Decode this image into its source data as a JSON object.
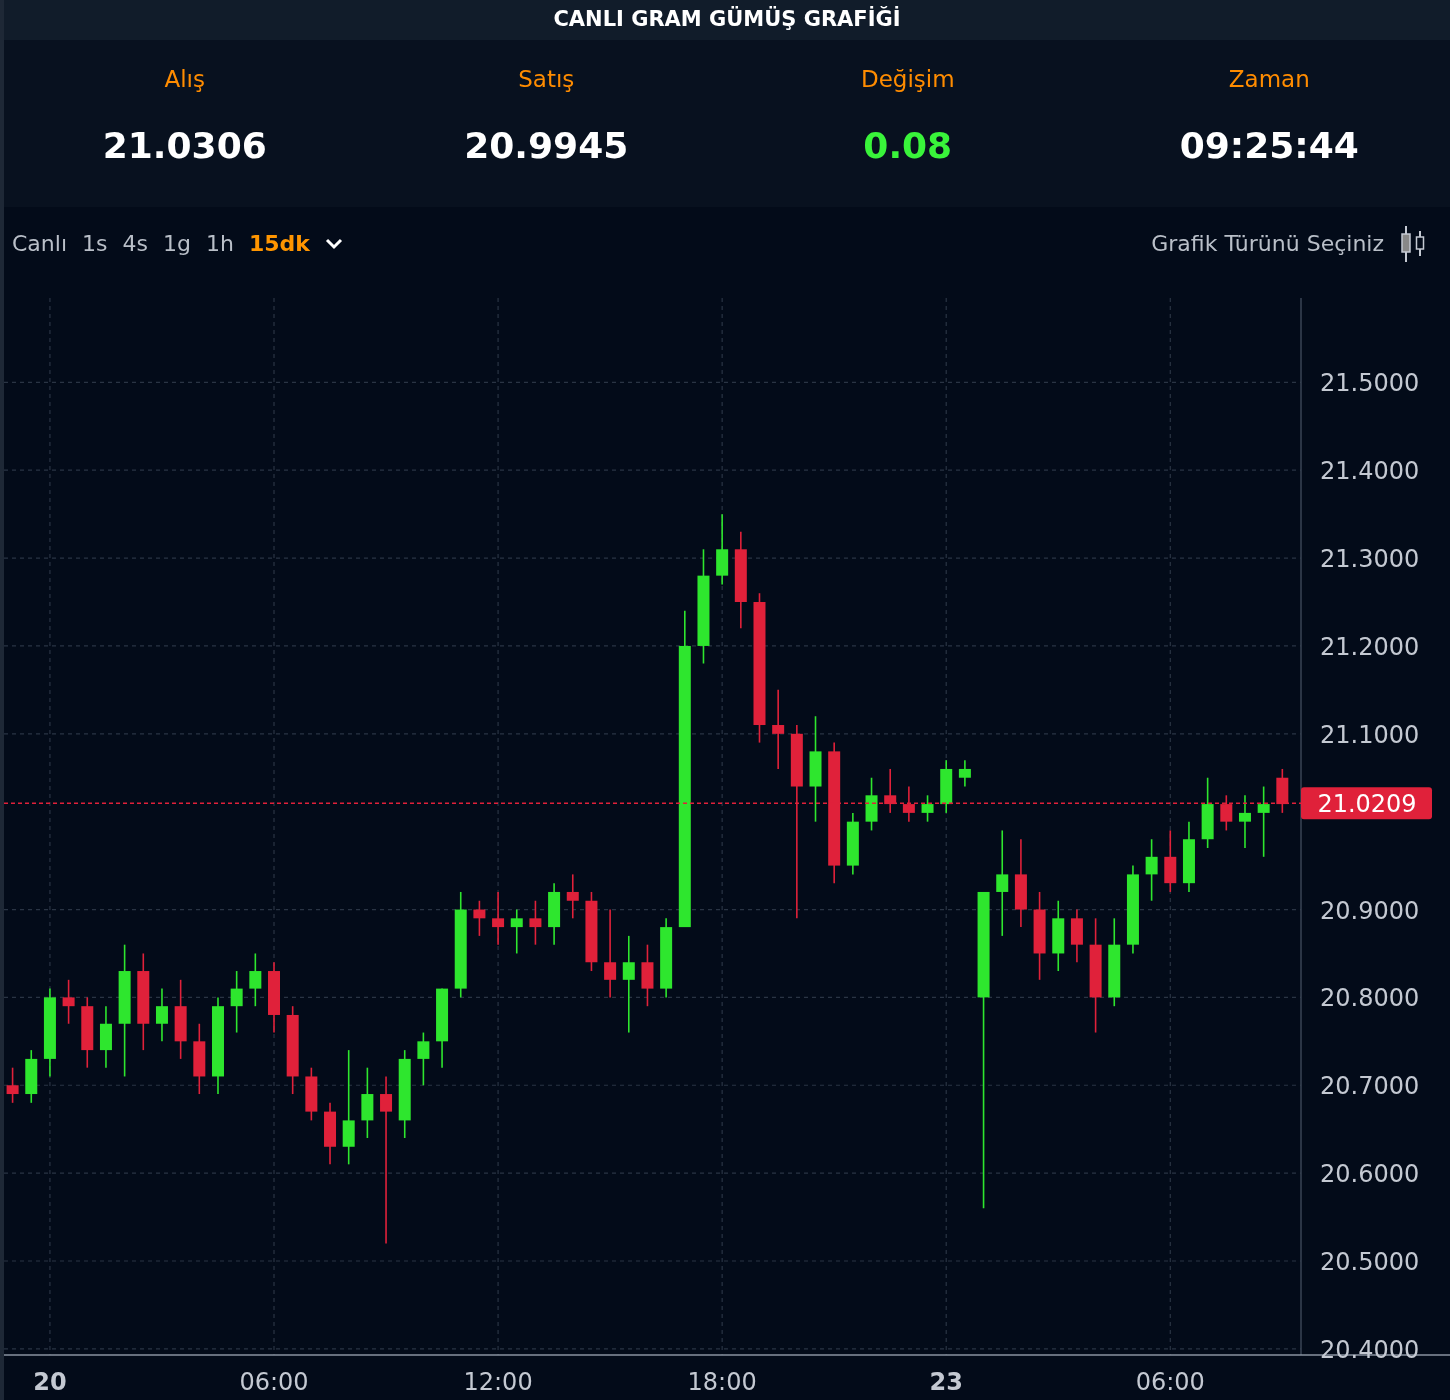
{
  "title": "CANLI GRAM GÜMÜŞ GRAFİĞİ",
  "stats": [
    {
      "label": "Alış",
      "value": "21.0306",
      "color": "#ffffff"
    },
    {
      "label": "Satış",
      "value": "20.9945",
      "color": "#ffffff"
    },
    {
      "label": "Değişim",
      "value": "0.08",
      "color": "#39f43a"
    },
    {
      "label": "Zaman",
      "value": "09:25:44",
      "color": "#ffffff"
    }
  ],
  "intervals": [
    {
      "label": "Canlı",
      "selected": false
    },
    {
      "label": "1s",
      "selected": false
    },
    {
      "label": "4s",
      "selected": false
    },
    {
      "label": "1g",
      "selected": false
    },
    {
      "label": "1h",
      "selected": false
    },
    {
      "label": "15dk",
      "selected": true
    }
  ],
  "chart_type_label": "Grafik Türünü Seçiniz",
  "chart_data": {
    "type": "candlestick",
    "ylim": [
      20.393,
      21.596
    ],
    "categories": [
      null,
      null,
      "20",
      null,
      null,
      null,
      null,
      null,
      null,
      null,
      null,
      null,
      null,
      null,
      "06:00",
      null,
      null,
      null,
      null,
      null,
      null,
      null,
      null,
      null,
      null,
      null,
      "12:00",
      null,
      null,
      null,
      null,
      null,
      null,
      null,
      null,
      null,
      null,
      null,
      "18:00",
      null,
      null,
      null,
      null,
      null,
      null,
      null,
      null,
      null,
      null,
      null,
      "23",
      null,
      null,
      null,
      null,
      null,
      null,
      null,
      null,
      null,
      null,
      null,
      "06:00",
      null,
      null,
      null,
      null,
      null,
      null
    ],
    "yticks": [
      {
        "value": 21.5,
        "label": "21.5000"
      },
      {
        "value": 21.4,
        "label": "21.4000"
      },
      {
        "value": 21.3,
        "label": "21.3000"
      },
      {
        "value": 21.2,
        "label": "21.2000"
      },
      {
        "value": 21.1,
        "label": "21.1000"
      },
      {
        "value": 20.9,
        "label": "20.9000"
      },
      {
        "value": 20.8,
        "label": "20.8000"
      },
      {
        "value": 20.7,
        "label": "20.7000"
      },
      {
        "value": 20.6,
        "label": "20.6000"
      },
      {
        "value": 20.5,
        "label": "20.5000"
      },
      {
        "value": 20.4,
        "label": "20.4000"
      }
    ],
    "series": [
      {
        "ohlc": [
          [
            20.7,
            20.72,
            20.68,
            20.69
          ],
          [
            20.69,
            20.74,
            20.68,
            20.73
          ],
          [
            20.73,
            20.81,
            20.71,
            20.8
          ],
          [
            20.8,
            20.82,
            20.77,
            20.79
          ],
          [
            20.79,
            20.8,
            20.72,
            20.74
          ],
          [
            20.74,
            20.79,
            20.72,
            20.77
          ],
          [
            20.77,
            20.86,
            20.71,
            20.83
          ],
          [
            20.83,
            20.85,
            20.74,
            20.77
          ],
          [
            20.77,
            20.81,
            20.75,
            20.79
          ],
          [
            20.79,
            20.82,
            20.73,
            20.75
          ],
          [
            20.75,
            20.77,
            20.69,
            20.71
          ],
          [
            20.71,
            20.8,
            20.69,
            20.79
          ],
          [
            20.79,
            20.83,
            20.76,
            20.81
          ],
          [
            20.81,
            20.85,
            20.79,
            20.83
          ],
          [
            20.83,
            20.84,
            20.76,
            20.78
          ],
          [
            20.78,
            20.79,
            20.69,
            20.71
          ],
          [
            20.71,
            20.72,
            20.66,
            20.67
          ],
          [
            20.67,
            20.68,
            20.61,
            20.63
          ],
          [
            20.63,
            20.74,
            20.61,
            20.66
          ],
          [
            20.66,
            20.72,
            20.64,
            20.69
          ],
          [
            20.69,
            20.71,
            20.52,
            20.67
          ],
          [
            20.66,
            20.74,
            20.64,
            20.73
          ],
          [
            20.73,
            20.76,
            20.7,
            20.75
          ],
          [
            20.75,
            20.81,
            20.72,
            20.81
          ],
          [
            20.81,
            20.92,
            20.8,
            20.9
          ],
          [
            20.9,
            20.91,
            20.87,
            20.89
          ],
          [
            20.89,
            20.92,
            20.86,
            20.88
          ],
          [
            20.88,
            20.9,
            20.85,
            20.89
          ],
          [
            20.89,
            20.91,
            20.86,
            20.88
          ],
          [
            20.88,
            20.93,
            20.86,
            20.92
          ],
          [
            20.92,
            20.94,
            20.89,
            20.91
          ],
          [
            20.91,
            20.92,
            20.83,
            20.84
          ],
          [
            20.84,
            20.9,
            20.8,
            20.82
          ],
          [
            20.82,
            20.87,
            20.76,
            20.84
          ],
          [
            20.84,
            20.86,
            20.79,
            20.81
          ],
          [
            20.81,
            20.89,
            20.8,
            20.88
          ],
          [
            20.88,
            21.24,
            20.88,
            21.2
          ],
          [
            21.2,
            21.31,
            21.18,
            21.28
          ],
          [
            21.28,
            21.35,
            21.27,
            21.31
          ],
          [
            21.31,
            21.33,
            21.22,
            21.25
          ],
          [
            21.25,
            21.26,
            21.09,
            21.11
          ],
          [
            21.11,
            21.15,
            21.06,
            21.1
          ],
          [
            21.1,
            21.11,
            20.89,
            21.04
          ],
          [
            21.04,
            21.12,
            21.0,
            21.08
          ],
          [
            21.08,
            21.09,
            20.93,
            20.95
          ],
          [
            20.95,
            21.01,
            20.94,
            21.0
          ],
          [
            21.0,
            21.05,
            20.99,
            21.03
          ],
          [
            21.03,
            21.06,
            21.01,
            21.02
          ],
          [
            21.02,
            21.04,
            21.0,
            21.01
          ],
          [
            21.01,
            21.03,
            21.0,
            21.02
          ],
          [
            21.02,
            21.07,
            21.01,
            21.06
          ],
          [
            21.05,
            21.07,
            21.04,
            21.06
          ],
          [
            20.8,
            20.92,
            20.56,
            20.92
          ],
          [
            20.92,
            20.99,
            20.87,
            20.94
          ],
          [
            20.94,
            20.98,
            20.88,
            20.9
          ],
          [
            20.9,
            20.92,
            20.82,
            20.85
          ],
          [
            20.85,
            20.91,
            20.83,
            20.89
          ],
          [
            20.89,
            20.9,
            20.84,
            20.86
          ],
          [
            20.86,
            20.89,
            20.76,
            20.8
          ],
          [
            20.8,
            20.89,
            20.79,
            20.86
          ],
          [
            20.86,
            20.95,
            20.85,
            20.94
          ],
          [
            20.94,
            20.98,
            20.91,
            20.96
          ],
          [
            20.96,
            20.99,
            20.92,
            20.93
          ],
          [
            20.93,
            21.0,
            20.92,
            20.98
          ],
          [
            20.98,
            21.05,
            20.97,
            21.02
          ],
          [
            21.02,
            21.03,
            20.99,
            21.0
          ],
          [
            21.0,
            21.03,
            20.97,
            21.01
          ],
          [
            21.01,
            21.04,
            20.96,
            21.02
          ],
          [
            21.05,
            21.06,
            21.01,
            21.02
          ]
        ]
      }
    ],
    "grid": true,
    "ref_lines": [
      {
        "axis": "y",
        "value": 21.0209,
        "label": "21.0209",
        "color": "#e0213a"
      }
    ]
  }
}
